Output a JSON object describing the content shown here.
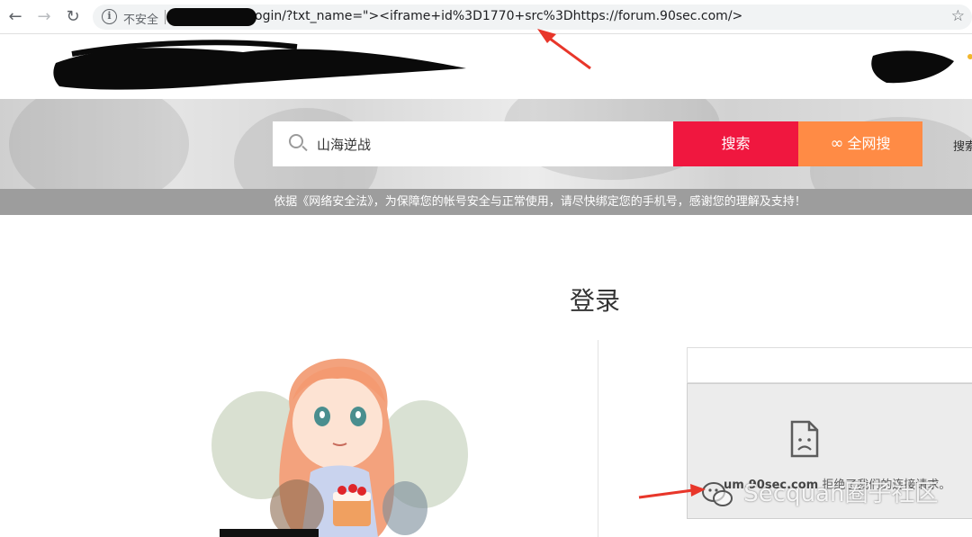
{
  "browser": {
    "security_label": "不安全",
    "url": "ogin/?txt_name=\"><iframe+id%3D1770+src%3Dhttps://forum.90sec.com/>",
    "info_icon": "info-icon",
    "star_icon": "star-icon"
  },
  "search": {
    "placeholder": "山海逆战",
    "value": "山海逆战",
    "search_button": "搜索",
    "all_button": "全网搜",
    "right_label": "搜索"
  },
  "notice": {
    "text": "依据《网络安全法》，为保障您的帐号安全与正常使用，请尽快绑定您的手机号，感谢您的理解及支持！"
  },
  "login": {
    "title": "登录"
  },
  "iframe": {
    "error_host": "um.90sec.com",
    "error_text": "拒绝了我们的连接请求。"
  },
  "watermark": {
    "text": "Secquan圈子社区"
  },
  "colors": {
    "search_button": "#f0173f",
    "all_button": "#ff8b45",
    "notice_bar": "#9d9d9d",
    "annotation_arrow": "#e8362a"
  }
}
